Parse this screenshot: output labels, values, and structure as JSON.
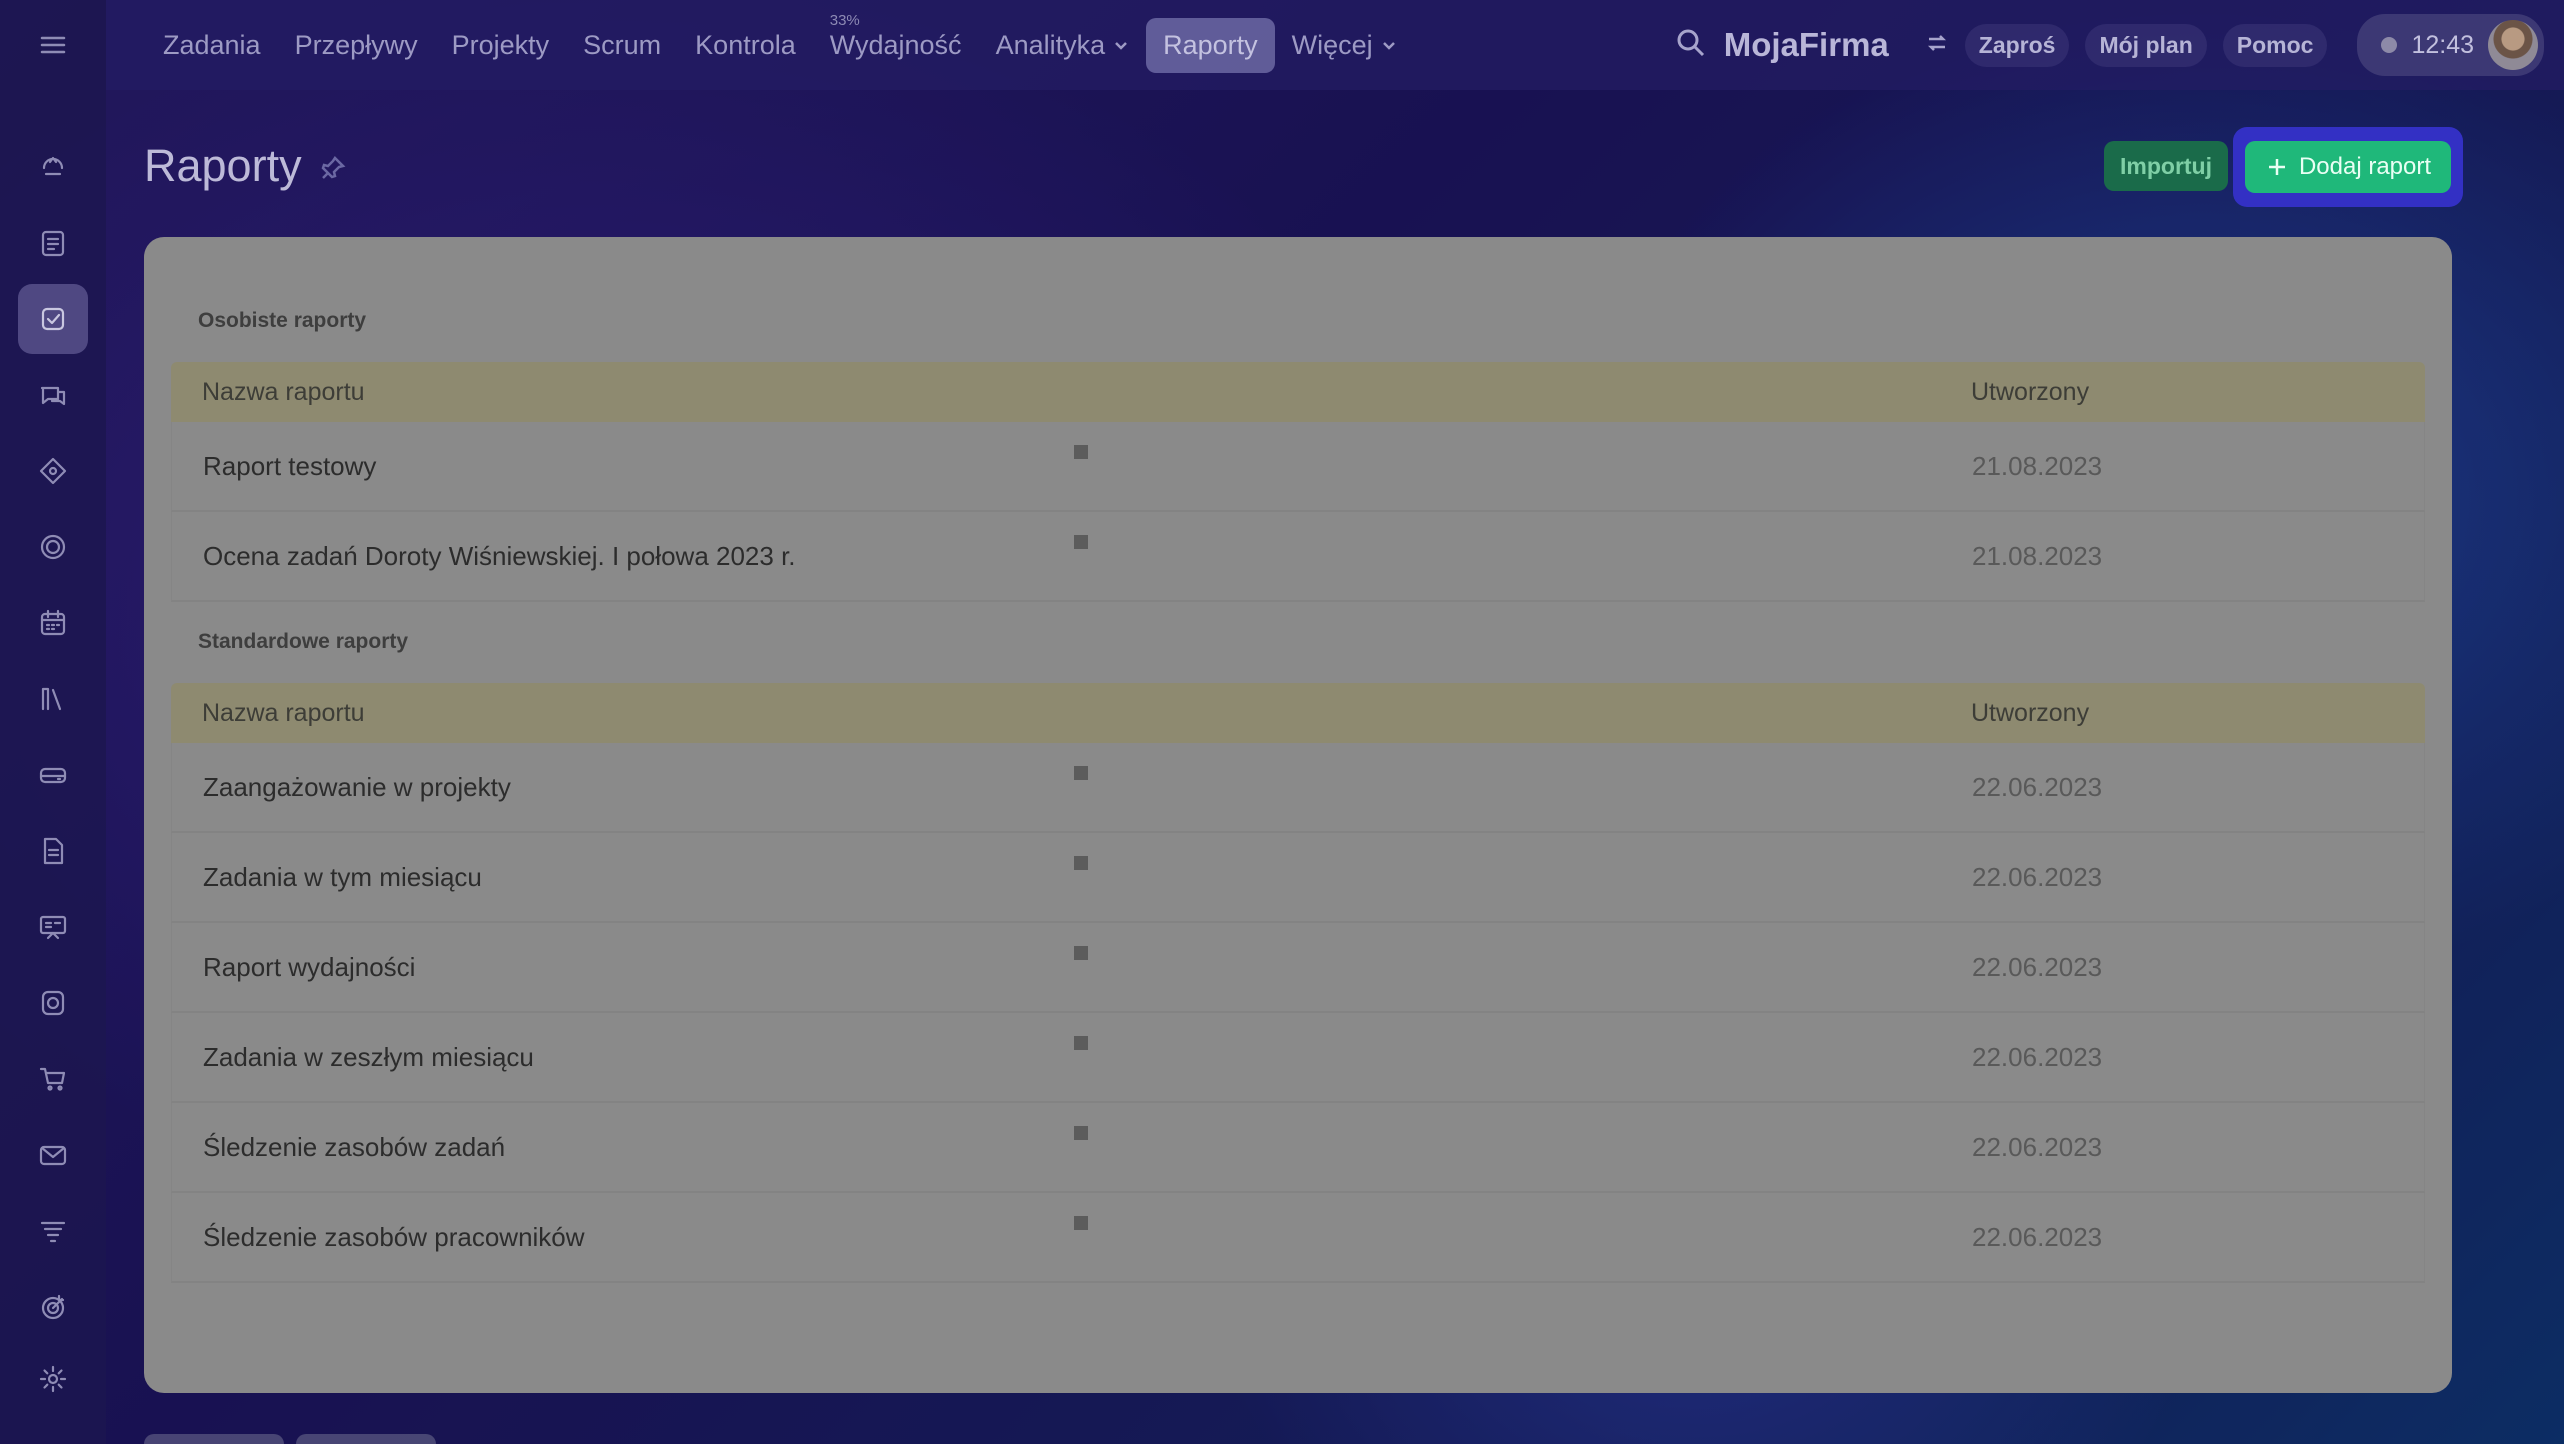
{
  "app": {
    "brand": "MojaFirma",
    "time": "12:43"
  },
  "topnav": {
    "items": [
      {
        "label": "Zadania"
      },
      {
        "label": "Przepływy"
      },
      {
        "label": "Projekty"
      },
      {
        "label": "Scrum"
      },
      {
        "label": "Kontrola"
      },
      {
        "label": "Wydajność",
        "badge": "33%"
      },
      {
        "label": "Analityka"
      },
      {
        "label": "Raporty"
      },
      {
        "label": "Więcej"
      }
    ],
    "invite": "Zaproś",
    "my_plan": "Mój plan",
    "help": "Pomoc"
  },
  "page": {
    "title": "Raporty",
    "import_label": "Importuj",
    "add_label": "Dodaj raport"
  },
  "personal": {
    "title": "Osobiste raporty",
    "col_name": "Nazwa raportu",
    "col_created": "Utworzony",
    "rows": [
      {
        "name": "Raport testowy",
        "date": "21.08.2023"
      },
      {
        "name": "Ocena zadań Doroty Wiśniewskiej. I połowa 2023 r.",
        "date": "21.08.2023"
      }
    ]
  },
  "standard": {
    "title": "Standardowe raporty",
    "col_name": "Nazwa raportu",
    "col_created": "Utworzony",
    "rows": [
      {
        "name": "Zaangażowanie w projekty",
        "date": "22.06.2023"
      },
      {
        "name": "Zadania w tym miesiącu",
        "date": "22.06.2023"
      },
      {
        "name": "Raport wydajności",
        "date": "22.06.2023"
      },
      {
        "name": "Zadania w zeszłym miesiącu",
        "date": "22.06.2023"
      },
      {
        "name": "Śledzenie zasobów zadań",
        "date": "22.06.2023"
      },
      {
        "name": "Śledzenie zasobów pracowników",
        "date": "22.06.2023"
      }
    ]
  },
  "colors": {
    "accent_green": "#1fb87a",
    "highlight_blue": "#3330c4",
    "table_header": "#8e8a70"
  }
}
